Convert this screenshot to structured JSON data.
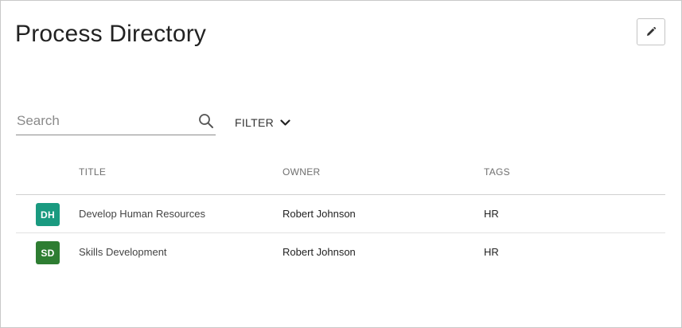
{
  "page": {
    "title": "Process Directory"
  },
  "toolbar": {
    "edit_icon": "pencil-icon"
  },
  "search": {
    "placeholder": "Search",
    "value": "",
    "icon": "search-icon"
  },
  "filter": {
    "label": "FILTER",
    "icon": "chevron-down-icon"
  },
  "table": {
    "headers": {
      "title": "TITLE",
      "owner": "OWNER",
      "tags": "TAGS"
    },
    "rows": [
      {
        "initials": "DH",
        "avatar_color": "#1a9a80",
        "title": "Develop Human Resources",
        "owner": "Robert Johnson",
        "tags": "HR"
      },
      {
        "initials": "SD",
        "avatar_color": "#2e7d32",
        "title": "Skills Development",
        "owner": "Robert Johnson",
        "tags": "HR"
      }
    ]
  }
}
